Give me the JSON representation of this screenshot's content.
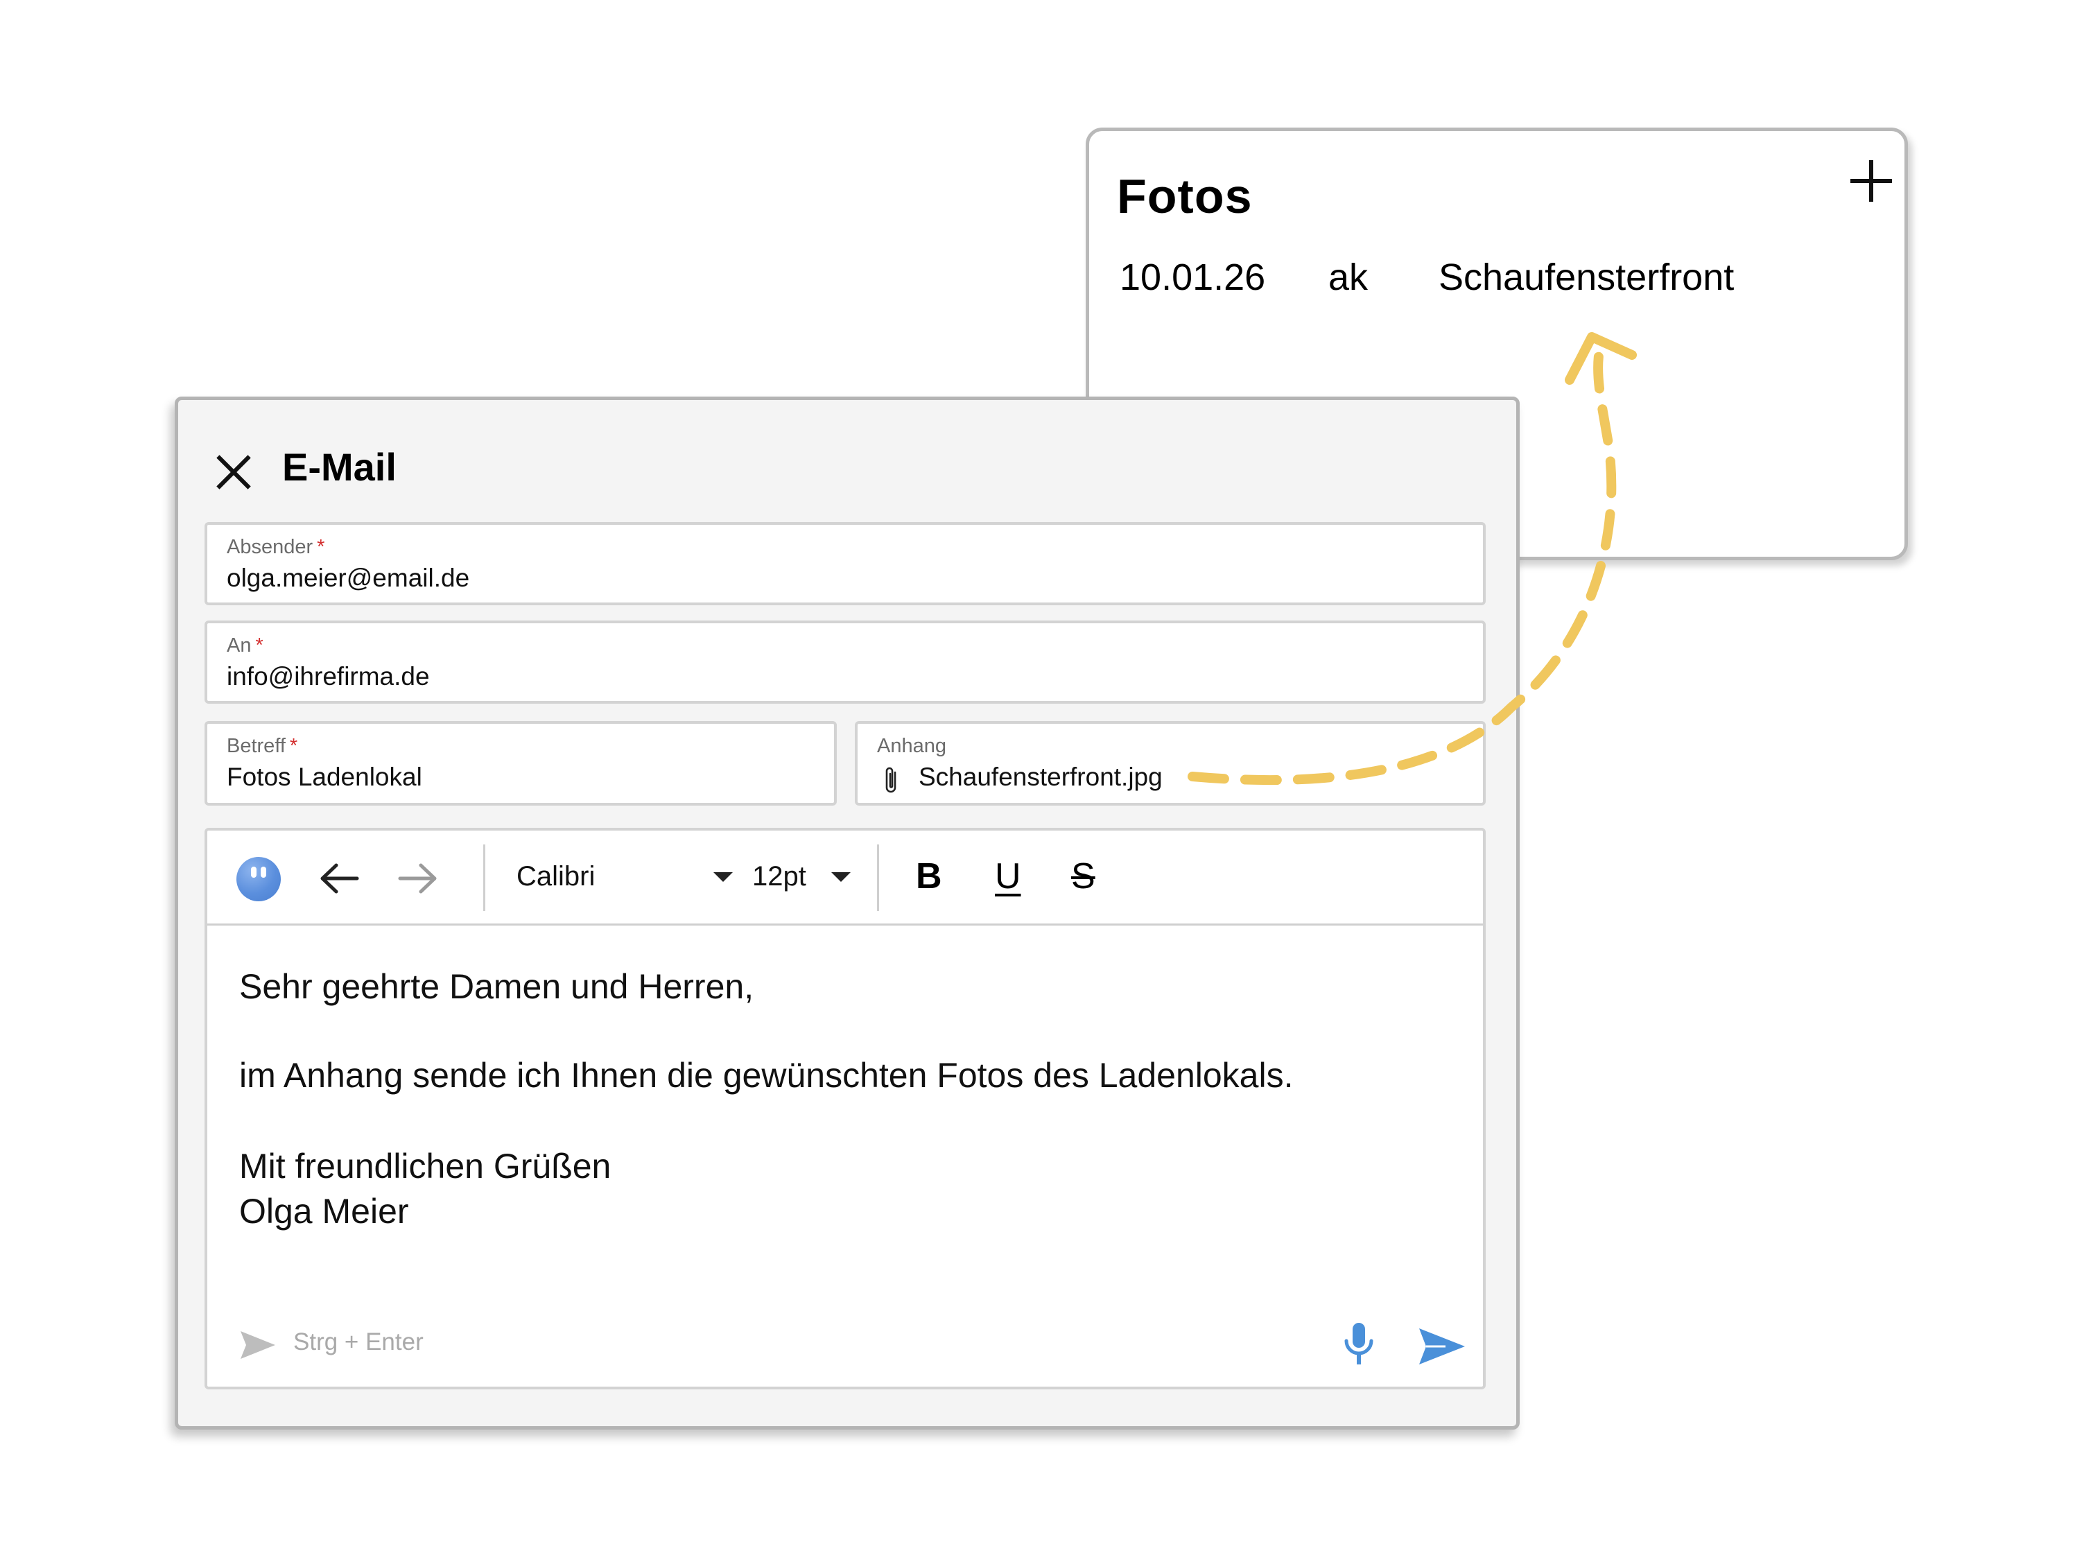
{
  "fotos": {
    "title": "Fotos",
    "add_icon": "plus-icon",
    "row": {
      "date": "10.01.26",
      "user": "ak",
      "description": "Schaufensterfront"
    }
  },
  "mail": {
    "title": "E-Mail",
    "close_icon": "close-icon",
    "from": {
      "label": "Absender",
      "required": "*",
      "value": "olga.meier@email.de"
    },
    "to": {
      "label": "An",
      "required": "*",
      "value": "info@ihrefirma.de"
    },
    "subject": {
      "label": "Betreff",
      "required": "*",
      "value": "Fotos Ladenlokal"
    },
    "attachment": {
      "label": "Anhang",
      "icon": "paperclip-icon",
      "value": "Schaufensterfront.jpg"
    },
    "toolbar": {
      "font": "Calibri",
      "size": "12pt",
      "bold": "B",
      "underline": "U",
      "strike": "S"
    },
    "body": {
      "greeting": "Sehr geehrte Damen und Herren,",
      "text": "im Anhang sende ich Ihnen die gewünschten Fotos des Ladenlokals.",
      "closing": "Mit freundlichen Grüßen",
      "signature": "Olga Meier"
    },
    "send_hint": "Strg + Enter"
  },
  "colors": {
    "accent_blue": "#4a90d9",
    "arrow_yellow": "#f0c75e",
    "required_red": "#d32f2f"
  }
}
